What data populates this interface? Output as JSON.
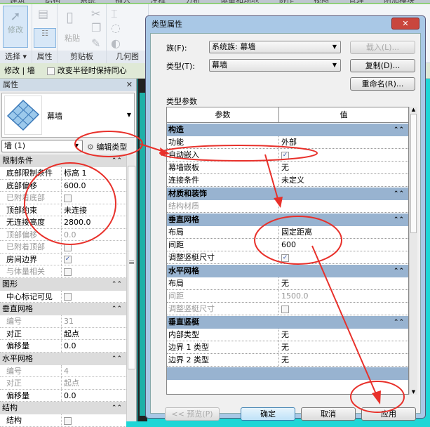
{
  "ribbon": {
    "tabs": [
      "建筑",
      "结构",
      "系统",
      "插入",
      "注释",
      "分析",
      "体量和场地",
      "协作",
      "视图",
      "管理",
      "附加模块",
      "修改 | 墙"
    ],
    "modify": "修改",
    "select": "选择",
    "properties": "属性",
    "paste": "粘贴",
    "clipboard": "剪贴板",
    "geometry": "几何图"
  },
  "options_bar": {
    "context": "修改 | 墙",
    "keep_concentric": "改变半径时保持同心"
  },
  "properties": {
    "title": "属性",
    "type_name": "幕墙",
    "instance": "墙 (1)",
    "edit_type": "编辑类型",
    "sections": [
      {
        "name": "限制条件",
        "rows": [
          {
            "k": "底部限制条件",
            "v": "标高 1"
          },
          {
            "k": "底部偏移",
            "v": "600.0"
          },
          {
            "k": "已附着底部",
            "v": "",
            "cb": "off",
            "grey": true
          },
          {
            "k": "顶部约束",
            "v": "未连接"
          },
          {
            "k": "无连接高度",
            "v": "2800.0"
          },
          {
            "k": "顶部偏移",
            "v": "0.0",
            "grey": true
          },
          {
            "k": "已附着顶部",
            "v": "",
            "cb": "off",
            "grey": true
          },
          {
            "k": "房间边界",
            "v": "",
            "cb": "on"
          },
          {
            "k": "与体量相关",
            "v": "",
            "cb": "off",
            "grey": true
          }
        ]
      },
      {
        "name": "图形",
        "rows": [
          {
            "k": "中心标记可见",
            "v": "",
            "cb": "off"
          }
        ]
      },
      {
        "name": "垂直网格",
        "rows": [
          {
            "k": "编号",
            "v": "31",
            "grey": true
          },
          {
            "k": "对正",
            "v": "起点"
          },
          {
            "k": "偏移量",
            "v": "0.0"
          }
        ]
      },
      {
        "name": "水平网格",
        "rows": [
          {
            "k": "编号",
            "v": "4",
            "grey": true
          },
          {
            "k": "对正",
            "v": "起点",
            "grey": true
          },
          {
            "k": "偏移量",
            "v": "0.0"
          }
        ]
      },
      {
        "name": "结构",
        "rows": [
          {
            "k": "结构",
            "v": "",
            "cb": "off"
          }
        ]
      }
    ]
  },
  "dialog": {
    "title": "类型属性",
    "close": "✕",
    "family_label": "族(F):",
    "family_value": "系统族: 幕墙",
    "type_label": "类型(T):",
    "type_value": "幕墙",
    "load": "载入(L)...",
    "duplicate": "复制(D)...",
    "rename": "重命名(R)...",
    "params_label": "类型参数",
    "col_param": "参数",
    "col_value": "值",
    "sections": [
      {
        "name": "构造",
        "rows": [
          {
            "k": "功能",
            "v": "外部"
          },
          {
            "k": "自动嵌入",
            "v": "",
            "cb": "on"
          },
          {
            "k": "幕墙嵌板",
            "v": "无"
          },
          {
            "k": "连接条件",
            "v": "未定义"
          }
        ]
      },
      {
        "name": "材质和装饰",
        "rows": [
          {
            "k": "结构材质",
            "v": "",
            "grey": true
          }
        ]
      },
      {
        "name": "垂直网格",
        "rows": [
          {
            "k": "布局",
            "v": "固定距离"
          },
          {
            "k": "间距",
            "v": "600"
          },
          {
            "k": "调整竖梃尺寸",
            "v": "",
            "cb": "on"
          }
        ]
      },
      {
        "name": "水平网格",
        "rows": [
          {
            "k": "布局",
            "v": "无"
          },
          {
            "k": "间距",
            "v": "1500.0",
            "grey": true
          },
          {
            "k": "调整竖梃尺寸",
            "v": "",
            "cb": "off",
            "grey": true
          }
        ]
      },
      {
        "name": "垂直竖梃",
        "rows": [
          {
            "k": "内部类型",
            "v": "无"
          },
          {
            "k": "边界 1 类型",
            "v": "无"
          },
          {
            "k": "边界 2 类型",
            "v": "无"
          }
        ]
      }
    ],
    "preview": "<< 预览(P)",
    "ok": "确定",
    "cancel": "取消",
    "apply": "应用"
  },
  "colors": {
    "annotation": "#e8302a",
    "section": "#98b3d0"
  }
}
